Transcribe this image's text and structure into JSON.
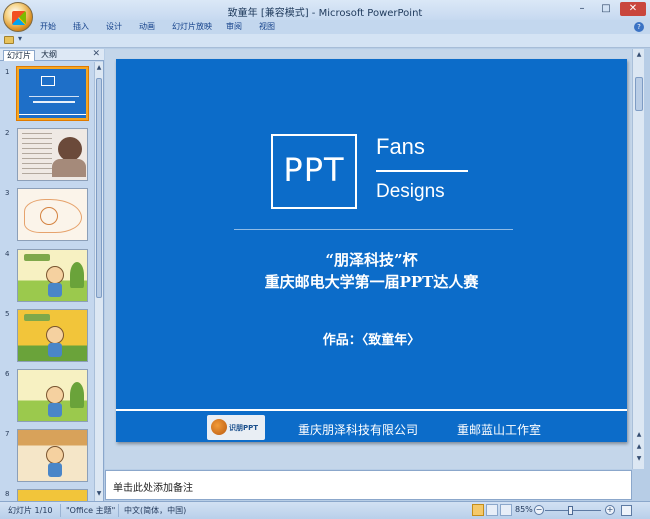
{
  "window": {
    "title": "致童年 [兼容模式] - Microsoft PowerPoint",
    "minimize": "–",
    "maximize": "□",
    "close": "✕"
  },
  "ribbon": {
    "tabs": [
      "开始",
      "插入",
      "设计",
      "动画",
      "幻灯片放映",
      "审阅",
      "视图"
    ],
    "help": "?"
  },
  "quick_access": {
    "dropdown": "▾"
  },
  "left_panel": {
    "tabs": [
      "幻灯片",
      "大纲"
    ],
    "close": "✕",
    "thumbnail_numbers": [
      "1",
      "2",
      "3",
      "4",
      "5",
      "6",
      "7",
      "8"
    ]
  },
  "slide": {
    "ppt_label": "PPT",
    "fans": "Fans",
    "designs": "Designs",
    "line1": "“朋泽科技”杯",
    "line2": "重庆邮电大学第一届PPT达人赛",
    "work": "作品：〈致童年〉",
    "logo_text": "识朋PPT",
    "company1": "重庆朋泽科技有限公司",
    "company2": "重邮蓝山工作室"
  },
  "notes": {
    "placeholder": "单击此处添加备注"
  },
  "status": {
    "slide_index": "幻灯片 1/10",
    "theme": "\"Office 主题\"",
    "language": "中文(简体，中国)",
    "zoom": "85%",
    "zoom_minus": "−",
    "zoom_plus": "+"
  }
}
